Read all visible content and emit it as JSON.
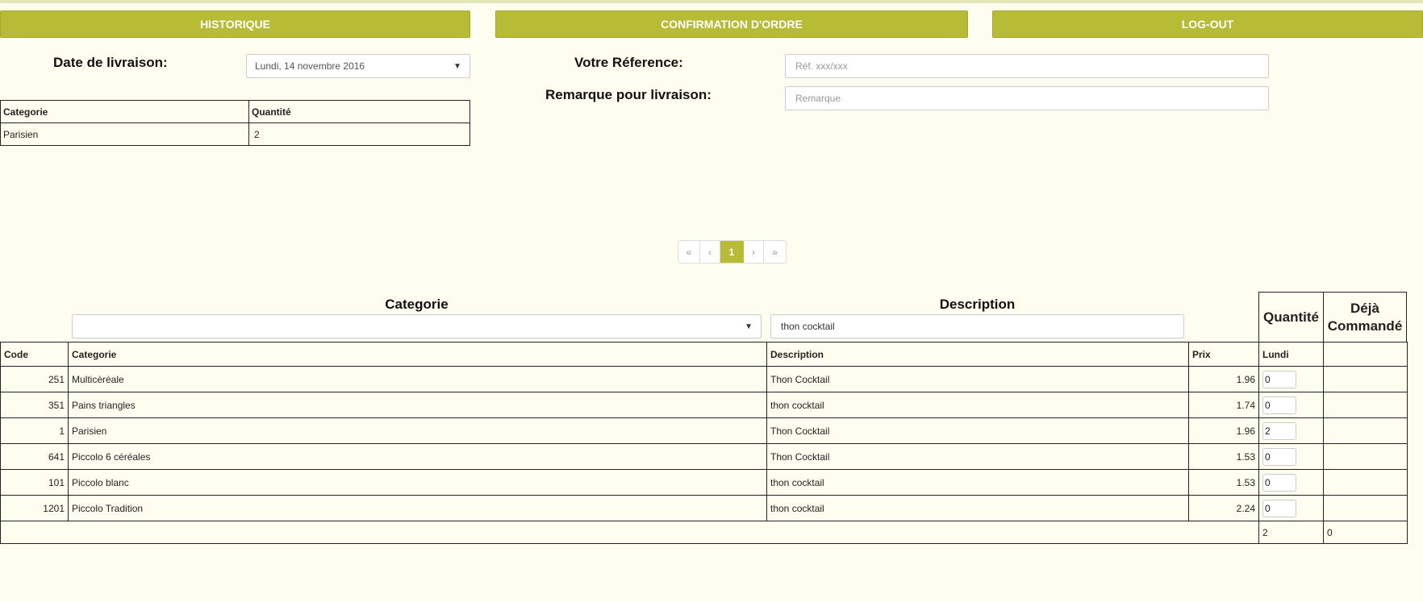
{
  "nav": {
    "historique": "HISTORIQUE",
    "confirmation": "CONFIRMATION D'ORDRE",
    "logout": "LOG-OUT"
  },
  "delivery": {
    "date_label": "Date de livraison:",
    "date_value": "Lundi, 14 novembre 2016",
    "reference_label": "Votre Réference:",
    "reference_placeholder": "Réf. xxx/xxx",
    "remark_label": "Remarque pour livraison:",
    "remark_placeholder": "Remarque"
  },
  "summary": {
    "headers": [
      "Categorie",
      "Quantité"
    ],
    "rows": [
      {
        "categorie": "Parisien",
        "quantite": "2"
      }
    ]
  },
  "pagination": {
    "first": "«",
    "prev": "‹",
    "current": "1",
    "next": "›",
    "last": "»"
  },
  "filters": {
    "categorie_title": "Categorie",
    "categorie_value": "",
    "description_title": "Description",
    "description_value": "thon cocktail"
  },
  "products": {
    "qty_title": "Quantité",
    "already_title": "Déjà Commandé",
    "headers": {
      "code": "Code",
      "categorie": "Categorie",
      "description": "Description",
      "prix": "Prix",
      "day": "Lundi"
    },
    "rows": [
      {
        "code": "251",
        "categorie": "Multicèréale",
        "description": "Thon Cocktail",
        "prix": "1.96",
        "qty": "0",
        "deja": ""
      },
      {
        "code": "351",
        "categorie": "Pains triangles",
        "description": "thon cocktail",
        "prix": "1.74",
        "qty": "0",
        "deja": ""
      },
      {
        "code": "1",
        "categorie": "Parisien",
        "description": "Thon Cocktail",
        "prix": "1.96",
        "qty": "2",
        "deja": ""
      },
      {
        "code": "641",
        "categorie": "Piccolo 6 céréales",
        "description": "Thon Cocktail",
        "prix": "1.53",
        "qty": "0",
        "deja": ""
      },
      {
        "code": "101",
        "categorie": "Piccolo blanc",
        "description": "thon cocktail",
        "prix": "1.53",
        "qty": "0",
        "deja": ""
      },
      {
        "code": "1201",
        "categorie": "Piccolo Tradition",
        "description": "thon cocktail",
        "prix": "2.24",
        "qty": "0",
        "deja": ""
      }
    ],
    "total_qty": "2",
    "total_deja": "0"
  },
  "colors": {
    "accent": "#b7bb36",
    "background": "#fefef0"
  }
}
